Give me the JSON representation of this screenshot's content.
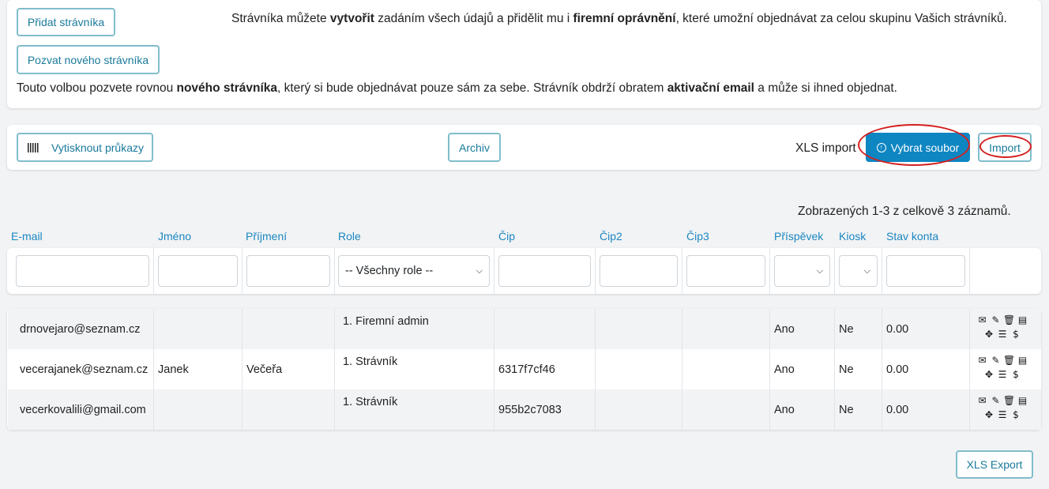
{
  "top": {
    "add_button": "Přidat strávníka",
    "invite_button": "Pozvat nového strávníka",
    "add_info": {
      "p1": "Strávníka můžete ",
      "b1": "vytvořit",
      "p2": " zadáním všech údajů a přidělit mu i ",
      "b2": "firemní oprávnění",
      "p3": ", které umožní objednávat za celou skupinu Vašich strávníků."
    },
    "invite_info": {
      "p1": "Touto volbou pozvete rovnou ",
      "b1": "nového strávníka",
      "p2": ", který si bude objednávat pouze sám za sebe. Strávník obdrží obratem ",
      "b2": "aktivační email",
      "p3": " a může si ihned objednat."
    }
  },
  "toolbar": {
    "print_button": "Vytisknout průkazy",
    "print_icon": "barcode-icon",
    "archive_button": "Archiv",
    "xls_import_label": "XLS import",
    "choose_file_button": "Vybrat soubor",
    "choose_file_icon": "upload-circle-icon",
    "import_button": "Import"
  },
  "summary": "Zobrazených 1-3 z celkově 3 záznamů.",
  "table": {
    "columns": [
      "E-mail",
      "Jméno",
      "Příjmení",
      "Role",
      "Čip",
      "Čip2",
      "Čip3",
      "Příspěvek",
      "Kiosk",
      "Stav konta"
    ],
    "role_filter": "-- Všechny role --",
    "rows": [
      {
        "email": "drnovejaro@seznam.cz",
        "first": "",
        "last": "",
        "role": "1. Firemní admin",
        "chip": "",
        "chip2": "",
        "chip3": "",
        "contribution": "Ano",
        "kiosk": "Ne",
        "balance": "0.00"
      },
      {
        "email": "vecerajanek@seznam.cz",
        "first": "Janek",
        "last": "Večeřa",
        "role": "1. Strávník",
        "chip": "6317f7cf46",
        "chip2": "",
        "chip3": "",
        "contribution": "Ano",
        "kiosk": "Ne",
        "balance": "0.00"
      },
      {
        "email": "vecerkovalili@gmail.com",
        "first": "",
        "last": "",
        "role": "1. Strávník",
        "chip": "955b2c7083",
        "chip2": "",
        "chip3": "",
        "contribution": "Ano",
        "kiosk": "Ne",
        "balance": "0.00"
      }
    ],
    "row_action_icons": [
      "envelope-icon",
      "pencil-icon",
      "trash-icon",
      "list-icon",
      "move-icon",
      "menu-icon",
      "dollar-icon"
    ]
  },
  "footer": {
    "export_button": "XLS Export"
  },
  "colors": {
    "accent": "#0e86c2",
    "link": "#1a86c0",
    "highlight": "#d42020"
  }
}
